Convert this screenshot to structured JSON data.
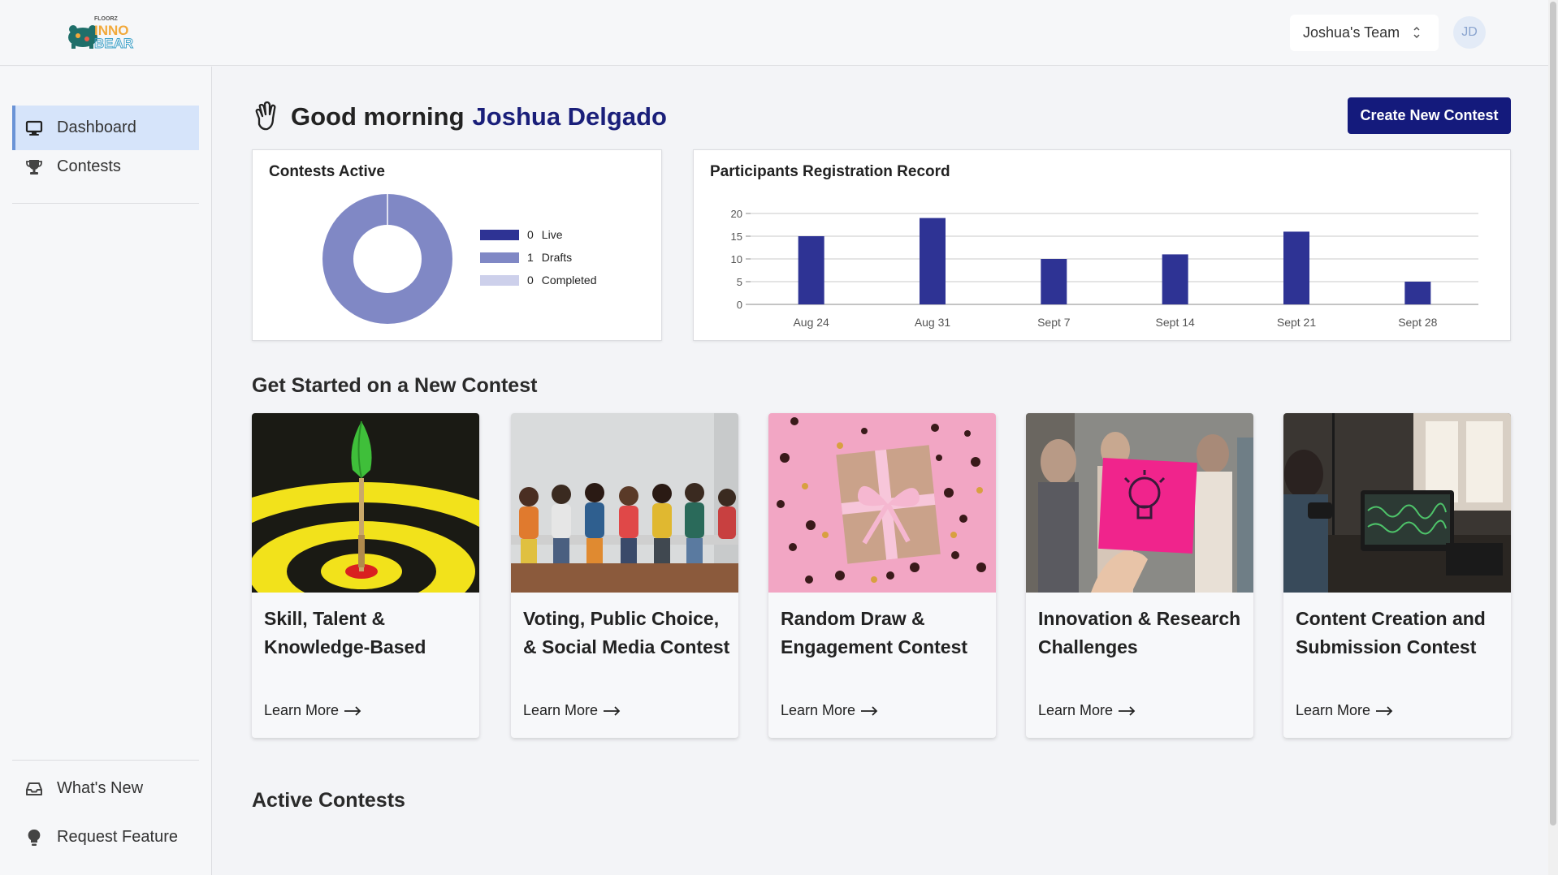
{
  "header": {
    "logo_top": "FLOORZ",
    "logo_line1": "INNO",
    "logo_line2": "BEAR",
    "team": "Joshua's Team",
    "avatar_initials": "JD"
  },
  "sidebar": {
    "items": [
      {
        "label": "Dashboard",
        "icon": "monitor-icon",
        "active": true
      },
      {
        "label": "Contests",
        "icon": "trophy-icon",
        "active": false
      }
    ],
    "bottom_items": [
      {
        "label": "What's New",
        "icon": "inbox-icon"
      },
      {
        "label": "Request Feature",
        "icon": "lightbulb-icon"
      }
    ]
  },
  "main": {
    "greeting": "Good morning",
    "user_name": "Joshua Delgado",
    "create_button": "Create New Contest",
    "contests_active": {
      "title": "Contests Active",
      "legend": [
        {
          "count": "0",
          "label": "Live",
          "color": "#2e3394"
        },
        {
          "count": "1",
          "label": "Drafts",
          "color": "#8088c5"
        },
        {
          "count": "0",
          "label": "Completed",
          "color": "#cdd0eb"
        }
      ]
    },
    "registration": {
      "title": "Participants Registration Record"
    },
    "get_started_title": "Get Started on a New Contest",
    "cards": [
      {
        "title": "Skill, Talent & Knowledge-Based",
        "link": "Learn More"
      },
      {
        "title": "Voting, Public Choice, & Social Media Contest",
        "link": "Learn More"
      },
      {
        "title": "Random Draw & Engagement Contest",
        "link": "Learn More"
      },
      {
        "title": "Innovation & Research Challenges",
        "link": "Learn More"
      },
      {
        "title": "Content Creation and Submission Contest",
        "link": "Learn More"
      }
    ],
    "active_contests_title": "Active Contests"
  },
  "chart_data": [
    {
      "type": "pie",
      "title": "Contests Active",
      "categories": [
        "Live",
        "Drafts",
        "Completed"
      ],
      "values": [
        0,
        1,
        0
      ],
      "donut": true
    },
    {
      "type": "bar",
      "title": "Participants Registration Record",
      "categories": [
        "Aug 24",
        "Aug 31",
        "Sept 7",
        "Sept 14",
        "Sept 21",
        "Sept 28"
      ],
      "values": [
        15,
        19,
        10,
        11,
        16,
        5
      ],
      "ylim": [
        0,
        20
      ],
      "yticks": [
        0,
        5,
        10,
        15,
        20
      ],
      "grid": true,
      "color": "#2e3394"
    }
  ]
}
